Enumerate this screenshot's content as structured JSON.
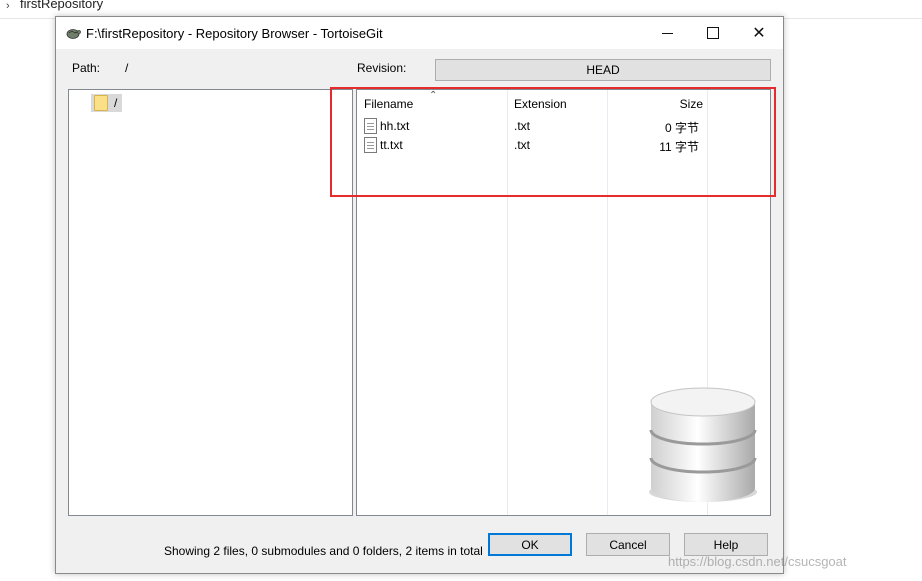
{
  "background": {
    "tree_label": "firstRepository"
  },
  "dialog": {
    "title": "F:\\firstRepository - Repository Browser - TortoiseGit",
    "path_label": "Path:",
    "path_value": "/",
    "revision_label": "Revision:",
    "revision_value": "HEAD",
    "tree": {
      "root_label": "/"
    },
    "list": {
      "columns": {
        "filename": "Filename",
        "extension": "Extension",
        "size": "Size"
      },
      "rows": [
        {
          "filename": "hh.txt",
          "extension": ".txt",
          "size": "0 字节"
        },
        {
          "filename": "tt.txt",
          "extension": ".txt",
          "size": "11 字节"
        }
      ]
    },
    "status": "Showing 2 files, 0 submodules and 0 folders, 2 items in total",
    "buttons": {
      "ok": "OK",
      "cancel": "Cancel",
      "help": "Help"
    }
  },
  "watermark": "https://blog.csdn.net/csucsgoat",
  "colors": {
    "highlight": "#e52b2b",
    "accent": "#0078d7"
  }
}
